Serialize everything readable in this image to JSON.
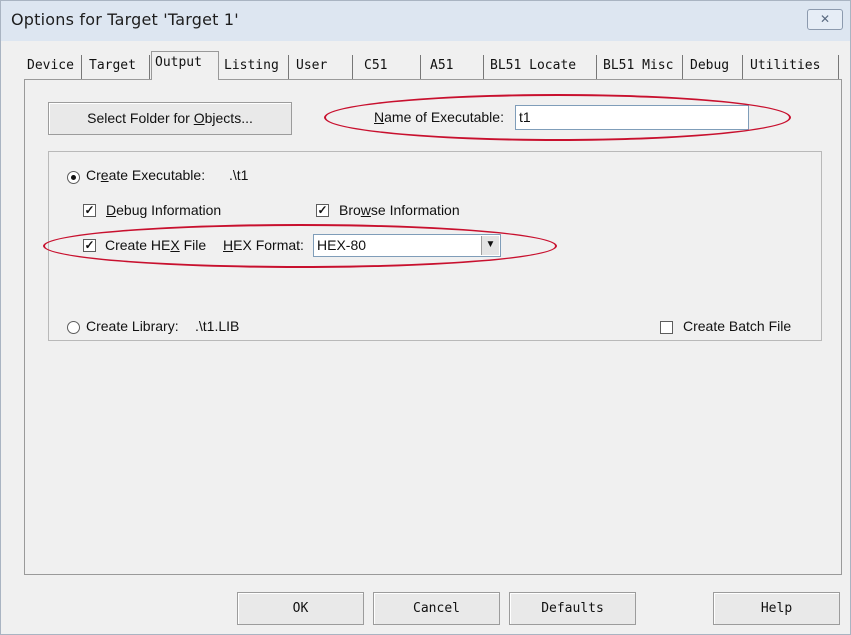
{
  "window": {
    "title": "Options for Target 'Target 1'",
    "close_glyph": "✕"
  },
  "tabs": [
    {
      "label": "Device"
    },
    {
      "label": "Target"
    },
    {
      "label": "Output"
    },
    {
      "label": "Listing"
    },
    {
      "label": "User"
    },
    {
      "label": "C51"
    },
    {
      "label": "A51"
    },
    {
      "label": "BL51 Locate"
    },
    {
      "label": "BL51 Misc"
    },
    {
      "label": "Debug"
    },
    {
      "label": "Utilities"
    }
  ],
  "active_tab": "Output",
  "output": {
    "select_folder_button": {
      "prefix": "Select Folder for ",
      "underlined": "O",
      "suffix": "bjects..."
    },
    "name_exe": {
      "underlined": "N",
      "rest": "ame of Executable:",
      "value": "t1"
    },
    "create_exe": {
      "prefix": "Cr",
      "underlined": "e",
      "suffix": "ate Executable:",
      "path": ".\\t1",
      "selected": true
    },
    "debug_info": {
      "underlined": "D",
      "rest": "ebug Information",
      "checked": true
    },
    "browse_info": {
      "prefix": "Bro",
      "underlined": "w",
      "suffix": "se Information",
      "checked": true
    },
    "create_hex": {
      "prefix": "Create HE",
      "underlined": "X",
      "suffix": " File",
      "checked": true
    },
    "hex_format": {
      "underlined": "H",
      "rest": "EX Format:",
      "value": "HEX-80"
    },
    "create_lib": {
      "label": "Create Library:",
      "path": ".\\t1.LIB",
      "selected": false
    },
    "create_batch": {
      "label": "Create Batch File",
      "checked": false
    }
  },
  "footer": {
    "ok": "OK",
    "cancel": "Cancel",
    "defaults": "Defaults",
    "help": "Help"
  },
  "colors": {
    "highlight_ellipse": "#c8102e",
    "titlebar": "#dde6f1",
    "dialog_bg": "#f0f0f0"
  }
}
